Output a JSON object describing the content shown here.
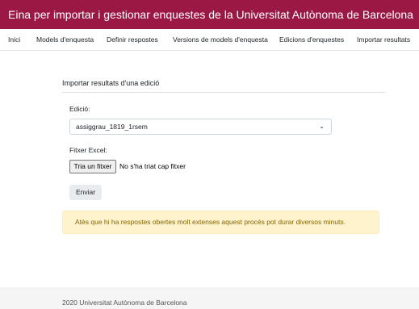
{
  "header": {
    "title": "Eina per importar i gestionar enquestes de la Universitat Autònoma de Barcelona"
  },
  "nav": {
    "items": [
      {
        "label": "Inici"
      },
      {
        "label": "Models d'enquesta"
      },
      {
        "label": "Definir respostes"
      },
      {
        "label": "Versions de models d'enquesta"
      },
      {
        "label": "Edicions d'enquestes"
      },
      {
        "label": "Importar resultats"
      }
    ]
  },
  "form": {
    "title": "Importar resultats d'una edició",
    "edition_label": "Edició:",
    "edition_value": "assiggrau_1819_1rsem",
    "file_label": "Fitxer Excel:",
    "file_button": "Tria un fitxer",
    "file_status": "No s'ha triat cap fitxer",
    "submit_label": "Enviar"
  },
  "alert": {
    "text": "Atès que hi ha respostes obertes molt extenses aquest procés pot durar diversos minuts."
  },
  "footer": {
    "text": "2020 Universitat Autònoma de Barcelona"
  }
}
